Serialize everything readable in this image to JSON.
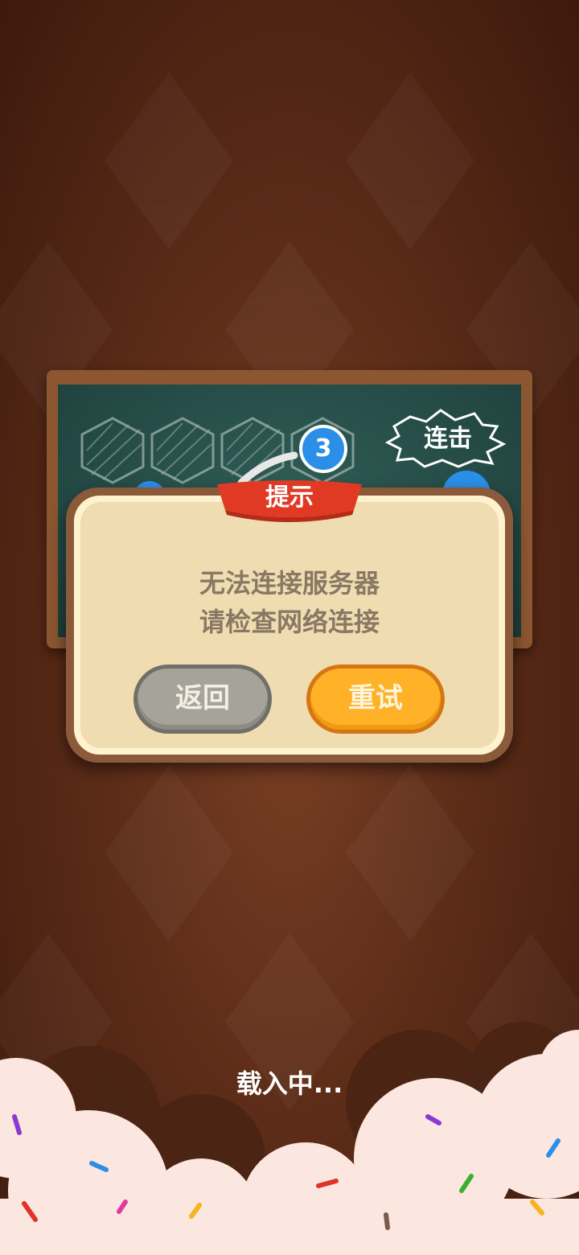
{
  "board": {
    "combo_label": "连击",
    "bubble_number": "3"
  },
  "dialog": {
    "title": "提示",
    "message_line1": "无法连接服务器",
    "message_line2": "请检查网络连接",
    "back_label": "返回",
    "retry_label": "重试"
  },
  "loading": {
    "text": "载入中..."
  },
  "colors": {
    "background": "#5c2c18",
    "chalkboard": "#234844",
    "dialog_panel": "#efddb1",
    "ribbon": "#e03a25",
    "retry_button": "#ffb128",
    "back_button": "#a5a39a",
    "bubble": "#2b8fe8"
  }
}
